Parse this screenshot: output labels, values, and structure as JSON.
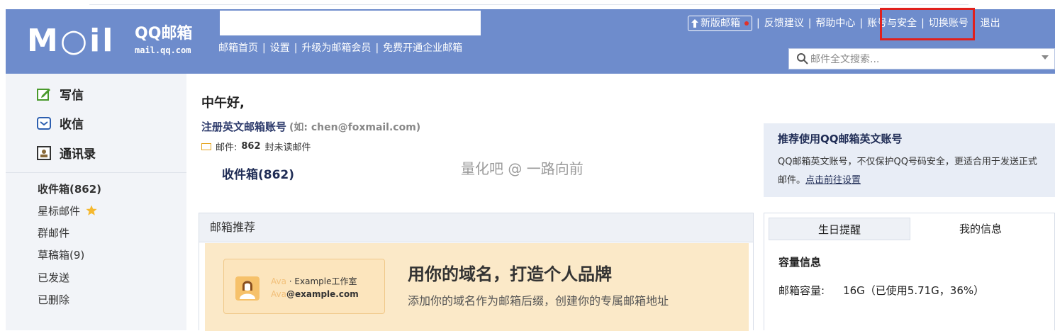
{
  "header": {
    "logo_text": "M○il",
    "logo_brand": "QQ邮箱",
    "logo_domain": "mail.qq.com",
    "nav": [
      "邮箱首页",
      "设置",
      "升级为邮箱会员",
      "免费开通企业邮箱"
    ],
    "new_version": "新版邮箱",
    "links": [
      "反馈建议",
      "帮助中心",
      "账号与安全",
      "切换账号",
      "退出"
    ],
    "search_placeholder": "邮件全文搜索..."
  },
  "sidebar": {
    "actions": [
      {
        "label": "写信",
        "icon": "compose-icon"
      },
      {
        "label": "收信",
        "icon": "inbox-tray-icon"
      },
      {
        "label": "通讯录",
        "icon": "contacts-icon"
      }
    ],
    "folders": [
      {
        "label": "收件箱(862)"
      },
      {
        "label": "星标邮件"
      },
      {
        "label": "群邮件"
      },
      {
        "label": "草稿箱(9)"
      },
      {
        "label": "已发送"
      },
      {
        "label": "已删除"
      }
    ]
  },
  "main": {
    "greeting": "中午好,",
    "register_title": "注册英文邮箱账号",
    "register_example": "(如: chen@foxmail.com)",
    "mail_prefix": "邮件:",
    "unread_count": "862",
    "unread_suffix": "封未读邮件",
    "inbox_label": "收件箱(862)",
    "watermark": "量化吧 @ 一路向前"
  },
  "promo": {
    "title": "推荐使用QQ邮箱英文账号",
    "desc": "QQ邮箱英文账号，不仅保护QQ号码安全，更适合用于发送正式邮件。",
    "link": "点击前往设置"
  },
  "recommend": {
    "header": "邮箱推荐",
    "card_line1_a": "Ava",
    "card_line1_b": "· Example工作室",
    "card_line2_a": "Ava",
    "card_line2_b": "@example.com",
    "headline": "用你的域名，打造个人品牌",
    "subline": "添加你的域名作为邮箱后缀，创建你的专属邮箱地址"
  },
  "info_panel": {
    "tabs": [
      "生日提醒",
      "我的信息"
    ],
    "heading": "容量信息",
    "capacity_label": "邮箱容量:",
    "capacity_value": "16G（已使用5.71G，36%）"
  },
  "colors": {
    "header_bg": "#6e8ccc",
    "highlight_border": "#e0201c",
    "star": "#f5b82e"
  }
}
